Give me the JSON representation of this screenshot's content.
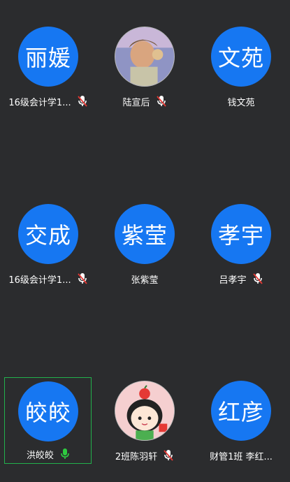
{
  "participants": [
    {
      "avatar_text": "丽媛",
      "name": "16级会计学1...",
      "mic": "muted",
      "photo": false
    },
    {
      "avatar_text": "",
      "name": "陆宣后",
      "mic": "muted",
      "photo": "child-photo"
    },
    {
      "avatar_text": "文苑",
      "name": "钱文苑",
      "mic": "none",
      "photo": false
    },
    {
      "avatar_text": "交成",
      "name": "16级会计学1...",
      "mic": "muted",
      "photo": false
    },
    {
      "avatar_text": "紫莹",
      "name": "张紫莹",
      "mic": "none",
      "photo": false
    },
    {
      "avatar_text": "孝宇",
      "name": "吕孝宇",
      "mic": "muted",
      "photo": false
    },
    {
      "avatar_text": "皎皎",
      "name": "洪皎皎",
      "mic": "active",
      "photo": false,
      "speaking": true
    },
    {
      "avatar_text": "",
      "name": "2班陈羽轩",
      "mic": "muted",
      "photo": "cartoon-girl"
    },
    {
      "avatar_text": "红彦",
      "name": "财管1班 李红...",
      "mic": "none",
      "photo": false
    }
  ],
  "colors": {
    "background": "#2b2c2e",
    "avatar": "#1677f2",
    "mic_muted": "#e53935",
    "mic_active": "#2ecc40",
    "speaking_border": "#22b14c"
  }
}
